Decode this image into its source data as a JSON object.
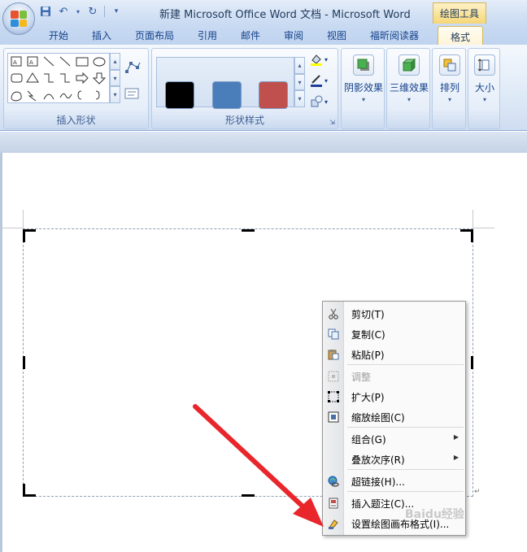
{
  "window": {
    "title": "新建 Microsoft Office Word 文档 - Microsoft Word",
    "contextual_tab": "绘图工具"
  },
  "tabs": [
    "开始",
    "插入",
    "页面布局",
    "引用",
    "邮件",
    "审阅",
    "视图",
    "福昕阅读器"
  ],
  "active_tab": "格式",
  "ribbon": {
    "insert_shapes": {
      "label": "插入形状"
    },
    "shape_styles": {
      "label": "形状样式",
      "swatches": [
        "#000000",
        "#4a7ebb",
        "#c0504d"
      ]
    },
    "shadow_effect": {
      "label": "阴影效果"
    },
    "threed_effect": {
      "label": "三维效果"
    },
    "arrange": {
      "label": "排列"
    },
    "size": {
      "label": "大小"
    }
  },
  "context_menu": {
    "items": [
      {
        "label": "剪切(T)",
        "icon": "scissors-icon",
        "disabled": false,
        "submenu": false
      },
      {
        "label": "复制(C)",
        "icon": "copy-icon",
        "disabled": false,
        "submenu": false
      },
      {
        "label": "粘贴(P)",
        "icon": "paste-icon",
        "disabled": false,
        "submenu": false
      },
      {
        "label": "调整",
        "icon": "fit-icon",
        "disabled": true,
        "submenu": false
      },
      {
        "label": "扩大(P)",
        "icon": "expand-icon",
        "disabled": false,
        "submenu": false
      },
      {
        "label": "缩放绘图(C)",
        "icon": "scale-drawing-icon",
        "disabled": false,
        "submenu": false
      },
      {
        "label": "组合(G)",
        "icon": "",
        "disabled": false,
        "submenu": true
      },
      {
        "label": "叠放次序(R)",
        "icon": "",
        "disabled": false,
        "submenu": true
      },
      {
        "label": "超链接(H)...",
        "icon": "hyperlink-icon",
        "disabled": false,
        "submenu": false
      },
      {
        "label": "插入题注(C)...",
        "icon": "caption-icon",
        "disabled": false,
        "submenu": false
      },
      {
        "label": "设置绘图画布格式(I)...",
        "icon": "format-canvas-icon",
        "disabled": false,
        "submenu": false
      }
    ]
  },
  "watermark": "Baidu经验"
}
